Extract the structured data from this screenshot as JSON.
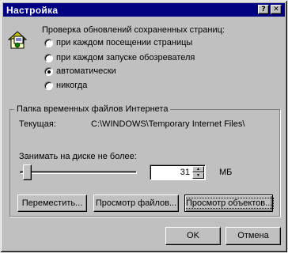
{
  "window": {
    "title": "Настройка",
    "help_label": "?",
    "close_label": "✕"
  },
  "update_check": {
    "heading": "Проверка обновлений сохраненных страниц:",
    "options": [
      {
        "label": "при каждом посещении страницы",
        "checked": false
      },
      {
        "label": "при каждом запуске обозревателя",
        "checked": false
      },
      {
        "label": "автоматически",
        "checked": true
      },
      {
        "label": "никогда",
        "checked": false
      }
    ]
  },
  "temp_folder": {
    "group_title": "Папка временных файлов Интернета",
    "current_label": "Текущая:",
    "current_path": "C:\\WINDOWS\\Temporary Internet Files\\",
    "disk_limit_label": "Занимать на диске не более:",
    "disk_limit_value": "31",
    "disk_limit_unit": "МБ",
    "disk_limit_fraction": 0.03,
    "buttons": [
      {
        "label": "Переместить..."
      },
      {
        "label": "Просмотр файлов..."
      },
      {
        "label": "Просмотр объектов..."
      }
    ]
  },
  "footer": {
    "ok_label": "OK",
    "cancel_label": "Отмена"
  },
  "icons": {
    "settings_icon": "house-with-paper-icon"
  }
}
